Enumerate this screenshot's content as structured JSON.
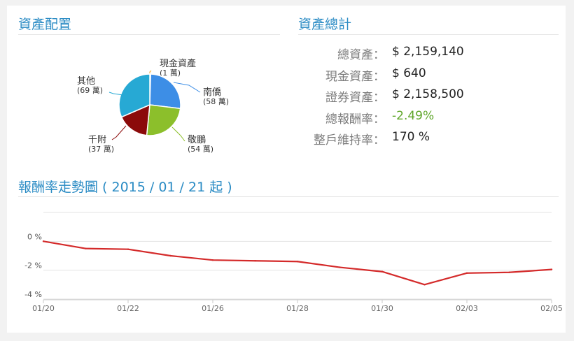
{
  "sections": {
    "allocation_title": "資產配置",
    "totals_title": "資產總計",
    "trend_title": "報酬率走勢圖 ( 2015 / 01 / 21 起 )"
  },
  "totals": [
    {
      "label": "總資產：",
      "value": "$ 2,159,140",
      "status": "normal"
    },
    {
      "label": "現金資產：",
      "value": "$ 640",
      "status": "normal"
    },
    {
      "label": "證券資產：",
      "value": "$ 2,158,500",
      "status": "normal"
    },
    {
      "label": "總報酬率：",
      "value": "-2.49%",
      "status": "negative"
    },
    {
      "label": "整戶維持率：",
      "value": "170 %",
      "status": "normal"
    }
  ],
  "colors": {
    "title": "#2a8bc4",
    "line": "#d42a2a",
    "negative_value": "#5fa62a"
  },
  "chart_data": [
    {
      "type": "pie",
      "title": "",
      "slices": [
        {
          "name": "現金資產",
          "count": "(1 萬)",
          "value": 1,
          "color": "#f5a623"
        },
        {
          "name": "南僑",
          "count": "(58 萬)",
          "value": 58,
          "color": "#3d8ee6"
        },
        {
          "name": "敬鵬",
          "count": "(54 萬)",
          "value": 54,
          "color": "#8cbf2b"
        },
        {
          "name": "千附",
          "count": "(37 萬)",
          "value": 37,
          "color": "#8b0a0a"
        },
        {
          "name": "其他",
          "count": "(69 萬)",
          "value": 69,
          "color": "#27a9d4"
        }
      ]
    },
    {
      "type": "line",
      "title": "",
      "xlabel": "",
      "ylabel": "",
      "x_ticks": [
        "01/20",
        "01/22",
        "01/26",
        "01/28",
        "01/30",
        "02/03",
        "02/05"
      ],
      "y_ticks": [
        "0 %",
        "-2 %",
        "-4 %"
      ],
      "ylim": [
        -4,
        2
      ],
      "grid": true,
      "series": [
        {
          "x": [
            "01/20",
            "01/21",
            "01/22",
            "01/23",
            "01/26",
            "01/27",
            "01/28",
            "01/29",
            "01/30",
            "02/02",
            "02/03",
            "02/04",
            "02/05"
          ],
          "values": [
            0.0,
            -0.5,
            -0.55,
            -1.0,
            -1.3,
            -1.35,
            -1.4,
            -1.8,
            -2.1,
            -3.0,
            -2.2,
            -2.15,
            -1.95
          ]
        }
      ]
    }
  ]
}
